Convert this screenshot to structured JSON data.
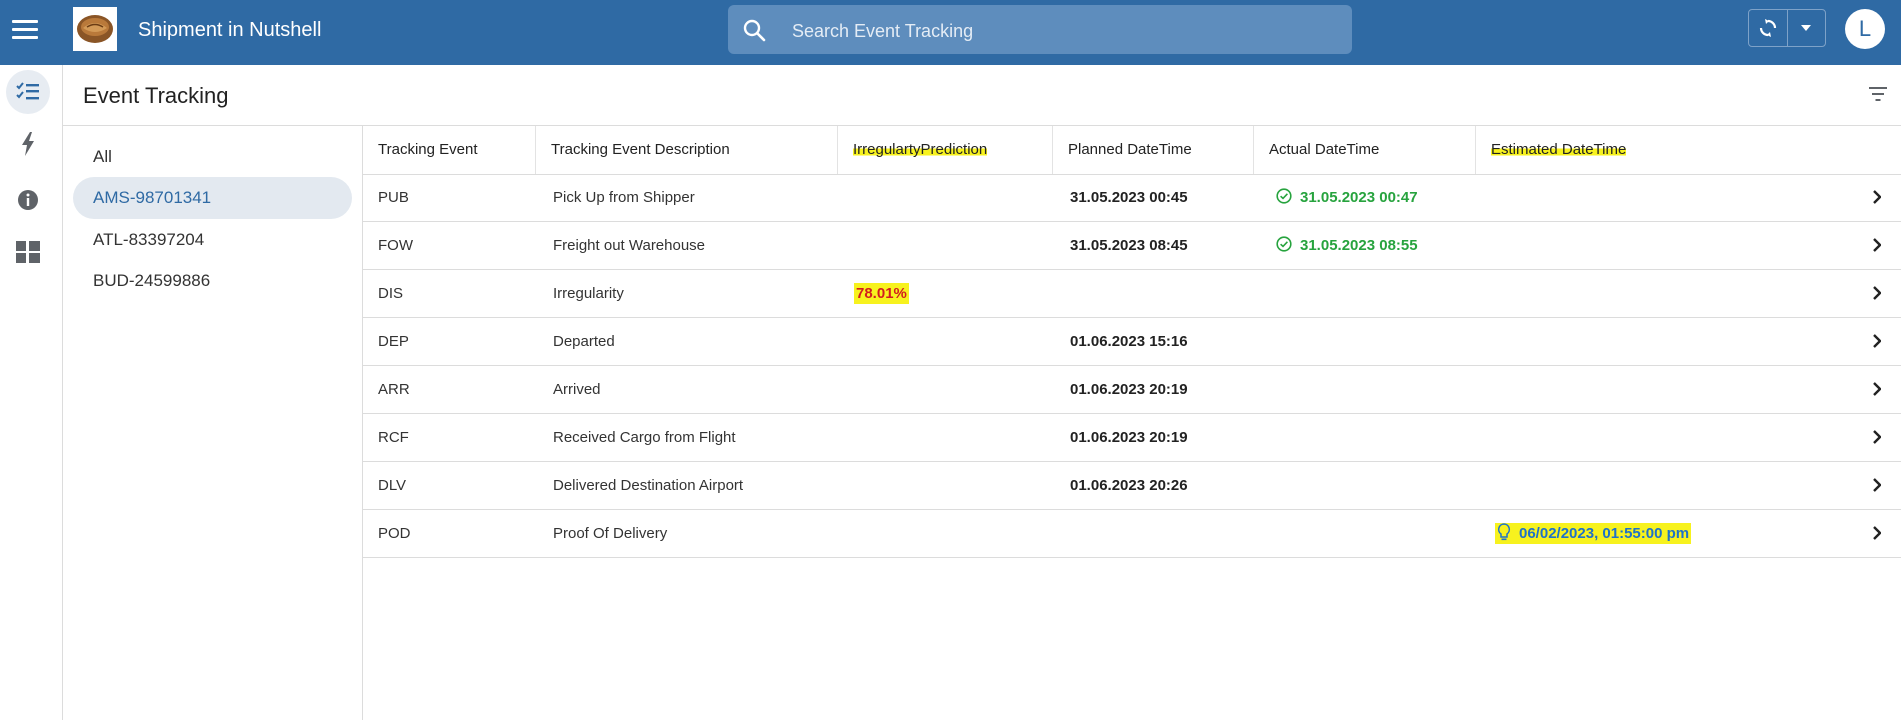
{
  "header": {
    "app_title": "Shipment in Nutshell",
    "search_placeholder": "Search Event Tracking",
    "avatar_letter": "L",
    "logo": "nutshell-logo"
  },
  "rail": {
    "items": [
      "checklist-icon",
      "bolt-icon",
      "info-icon",
      "dashboard-icon"
    ]
  },
  "page": {
    "title": "Event Tracking"
  },
  "shipments": {
    "items": [
      "All",
      "AMS-98701341",
      "ATL-83397204",
      "BUD-24599886"
    ],
    "selected": "AMS-98701341"
  },
  "table": {
    "columns": [
      "Tracking Event",
      "Tracking Event Description",
      "IrregulartyPrediction",
      "Planned DateTime",
      "Actual DateTime",
      "Estimated DateTime"
    ],
    "rows": [
      {
        "event": "PUB",
        "description": "Pick Up from Shipper",
        "prediction": "",
        "planned": "31.05.2023 00:45",
        "actual": "31.05.2023 00:47",
        "estimated": ""
      },
      {
        "event": "FOW",
        "description": "Freight out Warehouse",
        "prediction": "",
        "planned": "31.05.2023 08:45",
        "actual": "31.05.2023 08:55",
        "estimated": ""
      },
      {
        "event": "DIS",
        "description": "Irregularity",
        "prediction": "78.01%",
        "planned": "",
        "actual": "",
        "estimated": ""
      },
      {
        "event": "DEP",
        "description": "Departed",
        "prediction": "",
        "planned": "01.06.2023 15:16",
        "actual": "",
        "estimated": ""
      },
      {
        "event": "ARR",
        "description": "Arrived",
        "prediction": "",
        "planned": "01.06.2023 20:19",
        "actual": "",
        "estimated": ""
      },
      {
        "event": "RCF",
        "description": "Received Cargo from Flight",
        "prediction": "",
        "planned": "01.06.2023 20:19",
        "actual": "",
        "estimated": ""
      },
      {
        "event": "DLV",
        "description": "Delivered Destination Airport",
        "prediction": "",
        "planned": "01.06.2023 20:26",
        "actual": "",
        "estimated": ""
      },
      {
        "event": "POD",
        "description": "Proof Of Delivery",
        "prediction": "",
        "planned": "",
        "actual": "",
        "estimated": "06/02/2023, 01:55:00 pm"
      }
    ]
  },
  "colors": {
    "header_bg": "#2f6aa4",
    "actual_green": "#27a33e",
    "prediction_red": "#d21e1e",
    "estimated_blue": "#1f72c9",
    "highlight_yellow": "#f7f21e"
  }
}
